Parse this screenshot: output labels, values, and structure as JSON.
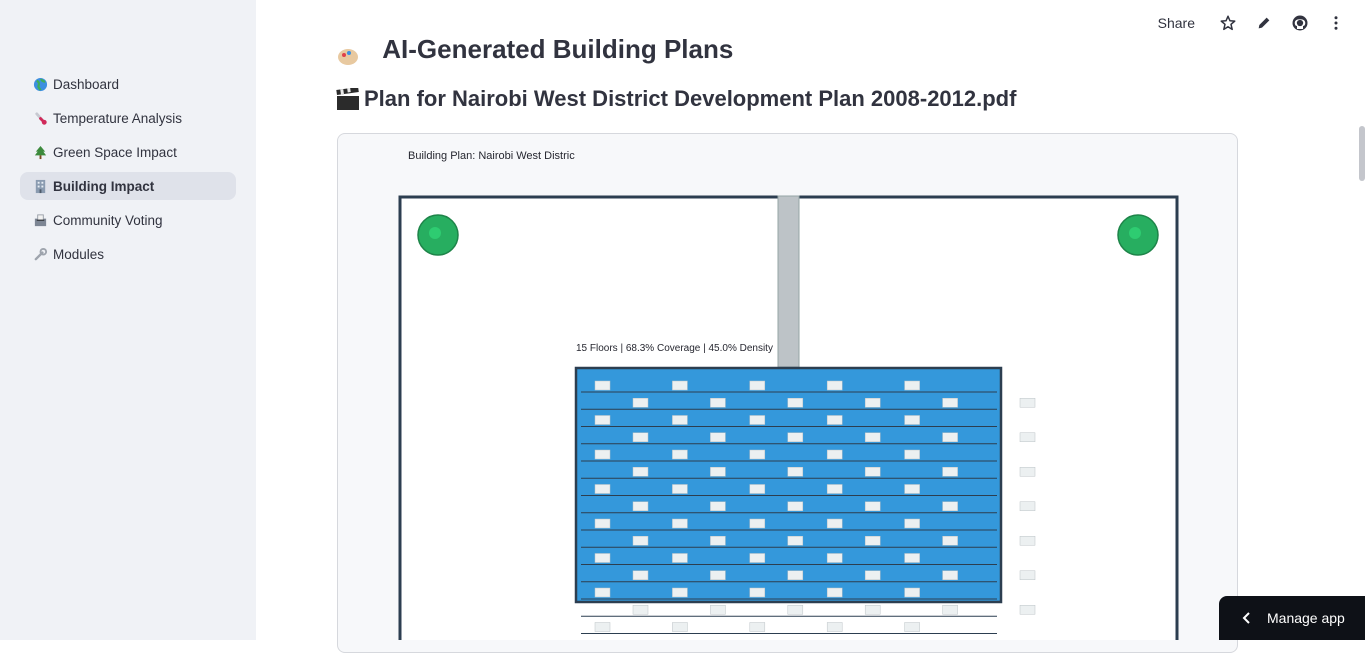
{
  "sidebar": {
    "items": [
      {
        "label": "Dashboard",
        "icon": "globe-icon",
        "active": false
      },
      {
        "label": "Temperature Analysis",
        "icon": "thermometer-icon",
        "active": false
      },
      {
        "label": "Green Space Impact",
        "icon": "tree-icon",
        "active": false
      },
      {
        "label": "Building Impact",
        "icon": "building-icon",
        "active": true
      },
      {
        "label": "Community Voting",
        "icon": "ballot-icon",
        "active": false
      },
      {
        "label": "Modules",
        "icon": "wrench-icon",
        "active": false
      }
    ]
  },
  "header": {
    "share_label": "Share",
    "icons": [
      "star-icon",
      "pencil-icon",
      "github-icon",
      "more-vertical-icon"
    ]
  },
  "main": {
    "partial_title": "AI-Generated Building Plans",
    "plan_heading": "Plan for Nairobi West District Development Plan 2008-2012.pdf",
    "plot": {
      "title": "Building Plan: Nairobi West Distric",
      "building_label": "15 Floors | 68.3% Coverage | 45.0% Density",
      "floors": 15,
      "coverage_pct": 68.3,
      "density_pct": 45.0,
      "colors": {
        "site_border": "#2c3e50",
        "building_fill": "#3498db",
        "tree": "#27ae60",
        "road": "#bdc3c7",
        "window": "#ecf0f1"
      }
    }
  },
  "footer": {
    "manage_app_label": "Manage app"
  }
}
